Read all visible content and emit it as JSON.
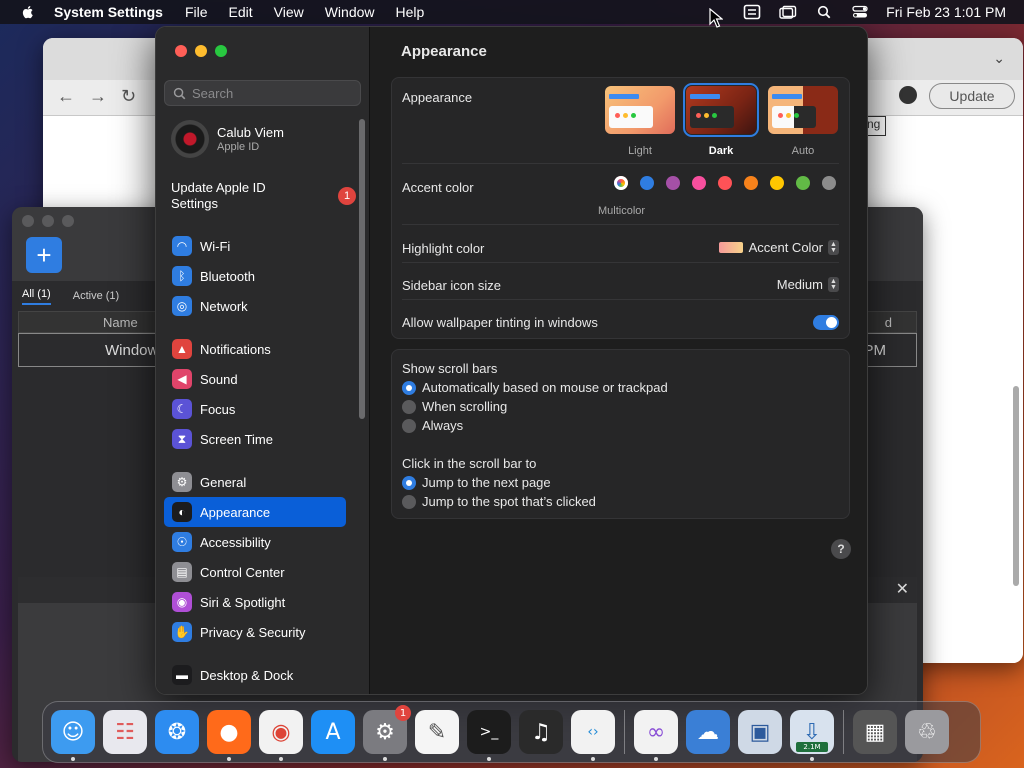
{
  "menubar": {
    "app_name": "System Settings",
    "menus": [
      "File",
      "Edit",
      "View",
      "Window",
      "Help"
    ],
    "clock": "Fri Feb 23  1:01 PM"
  },
  "background_browser": {
    "update_label": "Update",
    "fragment": "ng"
  },
  "background_app": {
    "tabs": [
      "All (1)",
      "Active (1)"
    ],
    "column_name": "Name",
    "row_name": "Window",
    "row_fragment": "PM",
    "column_fragment": "d"
  },
  "settings": {
    "search_placeholder": "Search",
    "profile": {
      "name": "Calub Viem",
      "subtitle": "Apple ID"
    },
    "update_apple_id": {
      "label": "Update Apple ID Settings",
      "badge": "1"
    },
    "sidebar_groups": [
      [
        {
          "label": "Wi-Fi",
          "icon": "wifi-icon",
          "color": "#2f7de1"
        },
        {
          "label": "Bluetooth",
          "icon": "bluetooth-icon",
          "color": "#2f7de1"
        },
        {
          "label": "Network",
          "icon": "globe-icon",
          "color": "#2f7de1"
        }
      ],
      [
        {
          "label": "Notifications",
          "icon": "bell-icon",
          "color": "#e0443e"
        },
        {
          "label": "Sound",
          "icon": "speaker-icon",
          "color": "#e0446a"
        },
        {
          "label": "Focus",
          "icon": "moon-icon",
          "color": "#5b53d6"
        },
        {
          "label": "Screen Time",
          "icon": "hourglass-icon",
          "color": "#5b53d6"
        }
      ],
      [
        {
          "label": "General",
          "icon": "gear-icon",
          "color": "#8e8e93"
        },
        {
          "label": "Appearance",
          "icon": "appearance-icon",
          "color": "#1c1c1e",
          "selected": true
        },
        {
          "label": "Accessibility",
          "icon": "accessibility-icon",
          "color": "#2f7de1"
        },
        {
          "label": "Control Center",
          "icon": "control-center-icon",
          "color": "#8e8e93"
        },
        {
          "label": "Siri & Spotlight",
          "icon": "siri-icon",
          "color": "#b04fd6"
        },
        {
          "label": "Privacy & Security",
          "icon": "hand-icon",
          "color": "#2f7de1"
        }
      ],
      [
        {
          "label": "Desktop & Dock",
          "icon": "dock-icon",
          "color": "#1c1c1e"
        }
      ]
    ],
    "main": {
      "title": "Appearance",
      "appearance_label": "Appearance",
      "appearance_options": [
        {
          "label": "Light",
          "selected": false
        },
        {
          "label": "Dark",
          "selected": true
        },
        {
          "label": "Auto",
          "selected": false
        }
      ],
      "accent_label": "Accent color",
      "accent_selected_label": "Multicolor",
      "accent_colors": [
        "multicolor",
        "#2f7de1",
        "#a550a7",
        "#f74f9e",
        "#ff5257",
        "#f7821b",
        "#ffc600",
        "#62ba46",
        "#8c8c8c"
      ],
      "highlight_label": "Highlight color",
      "highlight_value": "Accent Color",
      "sidebar_icon_label": "Sidebar icon size",
      "sidebar_icon_value": "Medium",
      "wallpaper_tint_label": "Allow wallpaper tinting in windows",
      "wallpaper_tint_on": true,
      "scroll_bars_label": "Show scroll bars",
      "scroll_bar_options": [
        {
          "label": "Automatically based on mouse or trackpad",
          "selected": true
        },
        {
          "label": "When scrolling",
          "selected": false
        },
        {
          "label": "Always",
          "selected": false
        }
      ],
      "click_scroll_label": "Click in the scroll bar to",
      "click_scroll_options": [
        {
          "label": "Jump to the next page",
          "selected": true
        },
        {
          "label": "Jump to the spot that’s clicked",
          "selected": false
        }
      ],
      "help_label": "?"
    }
  },
  "dock": {
    "apps": [
      {
        "name": "finder-icon",
        "color": "#3d9bf0"
      },
      {
        "name": "launchpad-icon",
        "color": "#e8e8ee"
      },
      {
        "name": "safari-icon",
        "color": "#2d8cf0"
      },
      {
        "name": "firefox-icon",
        "color": "#ff6a1a"
      },
      {
        "name": "chrome-icon",
        "color": "#f2f2f2"
      },
      {
        "name": "app-store-icon",
        "color": "#1e8ff5"
      },
      {
        "name": "system-settings-icon",
        "color": "#7b7b80",
        "badge": "1"
      },
      {
        "name": "textedit-icon",
        "color": "#f5f5f5"
      },
      {
        "name": "terminal-icon",
        "color": "#1c1c1c"
      },
      {
        "name": "garageband-icon",
        "color": "#2a2a2a"
      },
      {
        "name": "vscode-icon",
        "color": "#f2f2f2"
      },
      {
        "name": "visual-studio-icon",
        "color": "#f2f2f2"
      },
      {
        "name": "weather-icon",
        "color": "#3a7fd6"
      },
      {
        "name": "virtualbox-icon",
        "color": "#cfd9e6"
      },
      {
        "name": "downloader-icon",
        "color": "#d8e2ee",
        "progress_label": "2.1M"
      },
      {
        "name": "downloads-stack-icon",
        "color": "#555"
      },
      {
        "name": "trash-icon",
        "color": "#9a9a9e"
      }
    ]
  }
}
